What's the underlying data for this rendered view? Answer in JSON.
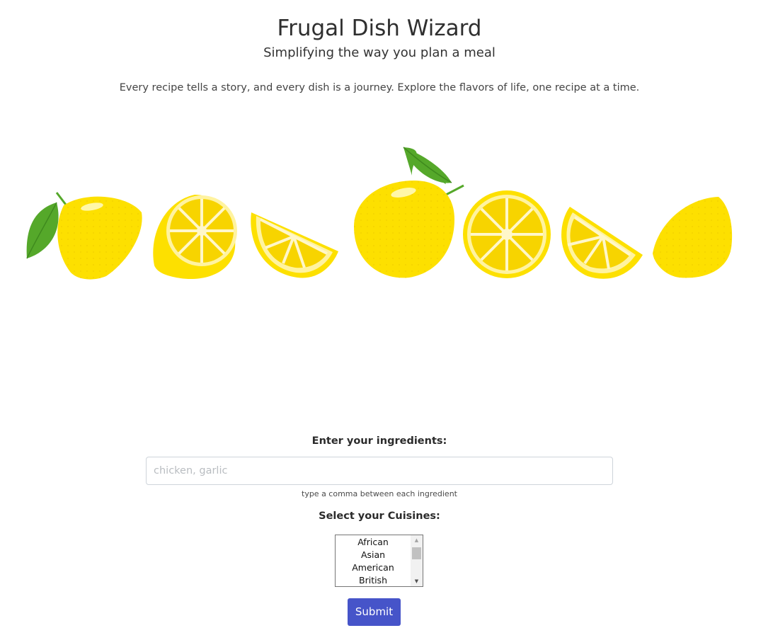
{
  "header": {
    "title": "Frugal Dish Wizard",
    "subtitle": "Simplifying the way you plan a meal",
    "tagline": "Every recipe tells a story, and every dish is a journey. Explore the flavors of life, one recipe at a time."
  },
  "banner": {
    "icons": [
      "lemon-with-leaf-icon",
      "lemon-half-icon",
      "lemon-wedge-icon",
      "whole-lemon-icon",
      "lemon-slice-icon",
      "lemon-wedge-icon",
      "lemon-icon"
    ],
    "colors": {
      "lemon": "#fde000",
      "pulp": "#f7d400",
      "rind": "#fff3a0",
      "leaf": "#55a82a",
      "leaf_dark": "#3f8a1e"
    }
  },
  "form": {
    "ingredients_label": "Enter your ingredients:",
    "ingredients_placeholder": "chicken, garlic",
    "ingredients_value": "",
    "ingredients_help": "type a comma between each ingredient",
    "cuisines_label": "Select your Cuisines:",
    "cuisines_options": [
      "African",
      "Asian",
      "American",
      "British"
    ],
    "submit_label": "Submit"
  },
  "colors": {
    "button": "#4654c9",
    "text": "#343a40"
  }
}
